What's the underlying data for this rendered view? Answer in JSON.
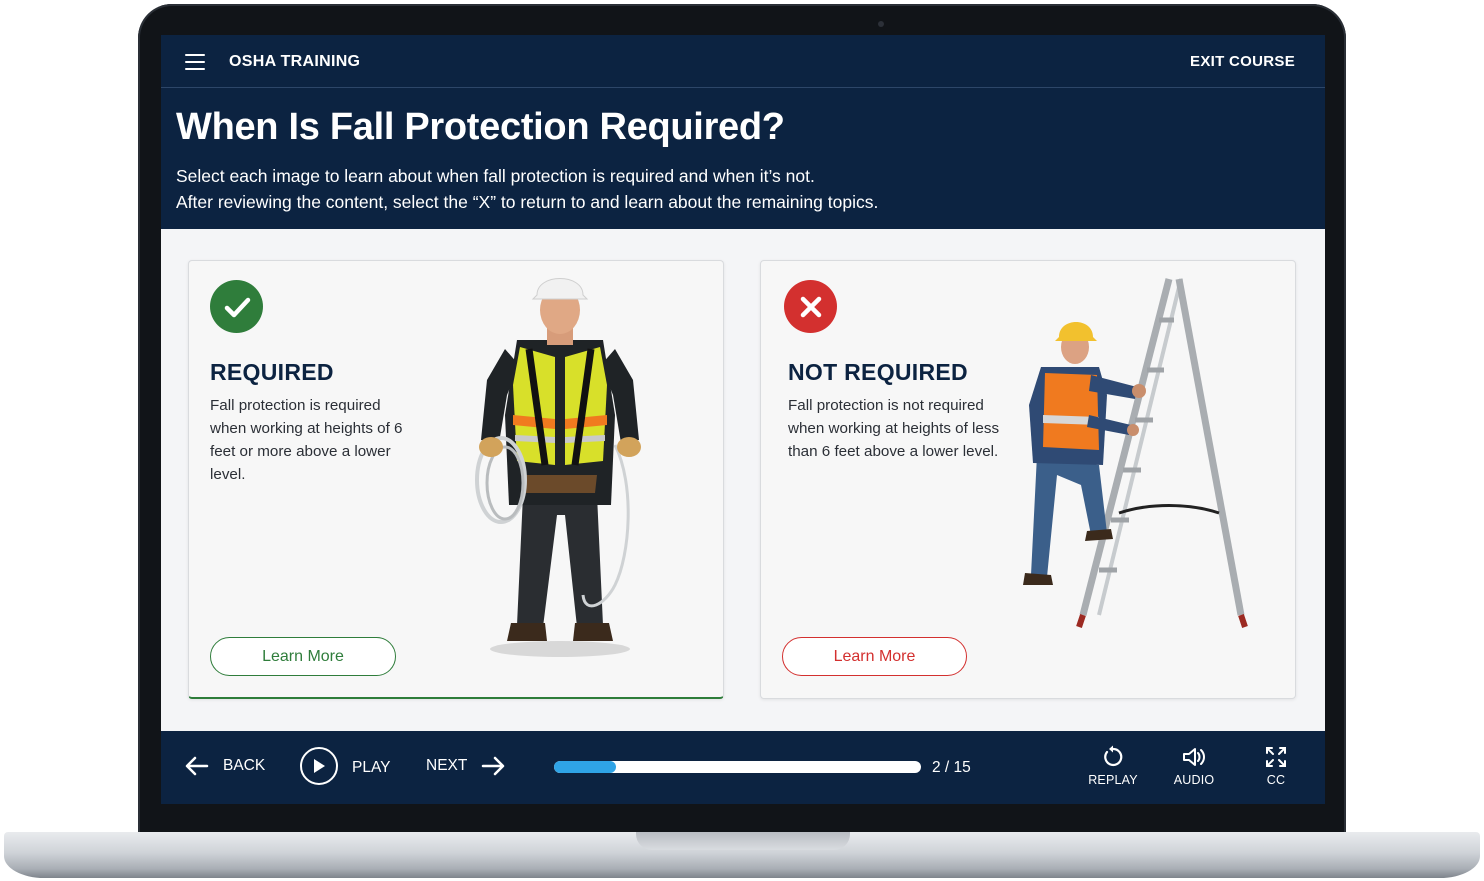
{
  "topbar": {
    "course_title": "OSHA TRAINING",
    "exit_label": "EXIT COURSE"
  },
  "header": {
    "title": "When Is Fall Protection Required?",
    "instruction_line1": "Select each image to learn about when fall protection is required and when it’s not.",
    "instruction_line2": "After reviewing the content, select the “X” to return to and learn about the remaining topics."
  },
  "cards": [
    {
      "heading": "REQUIRED",
      "text": "Fall protection is required when working at heights of 6 feet or more above a lower level.",
      "button_label": "Learn More",
      "icon": "checkmark-icon",
      "accent": "#2f7d3b"
    },
    {
      "heading": "NOT REQUIRED",
      "text": "Fall protection is not required when working at heights of less than 6 feet above a lower level.",
      "button_label": "Learn More",
      "icon": "x-icon",
      "accent": "#d3302f"
    }
  ],
  "player": {
    "back_label": "BACK",
    "play_label": "PLAY",
    "next_label": "NEXT",
    "progress_fraction": 0.17,
    "page_counter": "2 / 15",
    "replay_label": "REPLAY",
    "audio_label": "AUDIO",
    "cc_label": "CC"
  },
  "colors": {
    "navy": "#0c2341",
    "progress": "#2fa4e7",
    "required": "#2f7d3b",
    "not_required": "#d3302f"
  }
}
